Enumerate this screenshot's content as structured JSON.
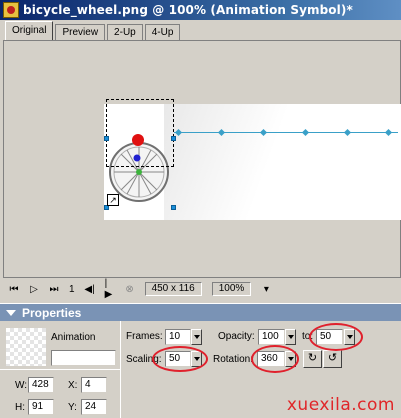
{
  "window": {
    "title": "bicycle_wheel.png @ 100% (Animation Symbol)*"
  },
  "tabs": [
    "Original",
    "Preview",
    "2-Up",
    "4-Up"
  ],
  "playback": {
    "frame": "1",
    "size": "450 x 116",
    "zoom": "100%"
  },
  "properties": {
    "header": "Properties",
    "symbol_type": "Animation",
    "name_value": "",
    "frames_label": "Frames:",
    "frames_value": "10",
    "opacity_label": "Opacity:",
    "opacity_value": "100",
    "to_label": "to:",
    "to_value": "50",
    "scaling_label": "Scaling:",
    "scaling_value": "50",
    "rotation_label": "Rotation:",
    "rotation_value": "360",
    "w_label": "W:",
    "w_value": "428",
    "h_label": "H:",
    "h_value": "91",
    "x_label": "X:",
    "x_value": "4",
    "y_label": "Y:",
    "y_value": "24"
  },
  "colors": {
    "highlight_ring": "#e0202c",
    "motion_path": "#3aa0c8",
    "title_bar": "#0a246a"
  },
  "watermark": "xuexila.com"
}
